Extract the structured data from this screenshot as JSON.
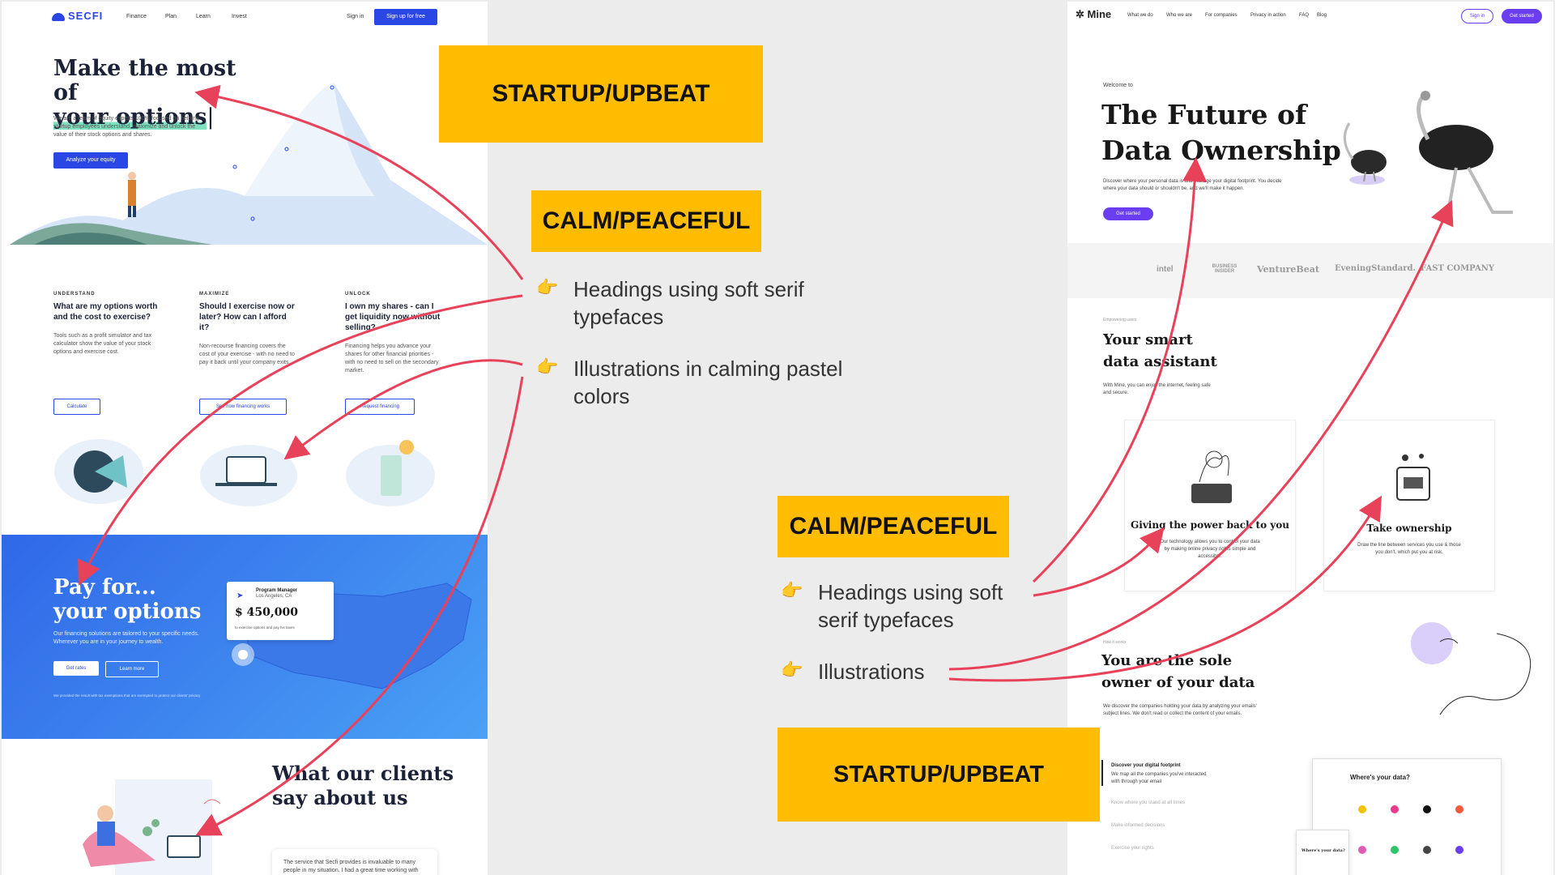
{
  "secfi": {
    "logo": "SECFI",
    "nav": [
      "Finance",
      "Plan",
      "Learn",
      "Invest"
    ],
    "sign_in": "Sign in",
    "signup": "Sign up for free",
    "hero_title_1": "Make the most of",
    "hero_title_2": "your options",
    "hero_body": "We are a team of equity experts 100% focused on helping startup employees understand, maximize and unlock the value of their stock options and shares.",
    "hero_cta": "Analyze your equity",
    "columns": [
      {
        "label": "UNDERSTAND",
        "question": "What are my options worth and the cost to exercise?",
        "body": "Tools such as a profit simulator and tax calculator show the value of your stock options and exercise cost.",
        "button": "Calculate"
      },
      {
        "label": "MAXIMIZE",
        "question": "Should I exercise now or later? How can I afford it?",
        "body": "Non-recourse financing covers the cost of your exercise - with no need to pay it back until your company exits.",
        "button": "See how financing works"
      },
      {
        "label": "UNLOCK",
        "question": "I own my shares - can I get liquidity now without selling?",
        "body": "Financing helps you advance your shares for other financial priorities - with no need to sell on the secondary market.",
        "button": "Request financing"
      }
    ],
    "pay_title_1": "Pay for...",
    "pay_title_2": "your options",
    "pay_body": "Our financing solutions are tailored to your specific needs. Wherever you are in your journey to wealth.",
    "get_rates": "Get rates",
    "learn_more": "Learn more",
    "pay_footnote": "We provided the result with tax exemptions that are exempted to protect our clients' privacy",
    "card_role": "Program Manager",
    "card_location": "Los Angeles, CA",
    "card_amount": "$ 450,000",
    "card_caption": "to exercise options and pay his taxes",
    "clients_title_1": "What our clients",
    "clients_title_2": "say about us",
    "quote": "The service that Secfi provides is invaluable to many people in my situation. I had a great time working with"
  },
  "annotations": {
    "tag_top_left": "STARTUP/UPBEAT",
    "tag_calm_left": "CALM/PEACEFUL",
    "bullets_left": [
      "Headings using soft serif typefaces",
      "Illustrations in calming pastel colors"
    ],
    "tag_calm_right": "CALM/PEACEFUL",
    "bullets_right": [
      "Headings using soft serif typefaces",
      "Illustrations"
    ],
    "tag_bottom_right": "STARTUP/UPBEAT",
    "pointer_icon": "👉",
    "tag_color": "#ffbc00",
    "arrow_color": "#e8415a"
  },
  "mine": {
    "logo": "Mine",
    "nav": [
      "What we do",
      "Who we are",
      "For companies",
      "Privacy in action",
      "FAQ",
      "Blog"
    ],
    "sign_in": "Sign in",
    "get_started": "Get started",
    "welcome": "Welcome to",
    "hero_title_1": "The Future of",
    "hero_title_2": "Data Ownership",
    "hero_body": "Discover where your personal data is and manage your digital footprint. You decide where your data should or shouldn't be, and we'll make it happen.",
    "hero_cta": "Get started",
    "press": [
      "intel",
      "BUSINESS INSIDER",
      "VentureBeat",
      "EveningStandard.",
      "FAST COMPANY"
    ],
    "eyebrow": "Empowering users",
    "assistant_title_1": "Your smart",
    "assistant_title_2": "data assistant",
    "assistant_body": "With Mine, you can enjoy the internet, feeling safe and secure.",
    "card1_title": "Giving the power back to you",
    "card1_body": "Our technology allows you to control your data by making online privacy rights simple and accessible.",
    "card2_title": "Take ownership",
    "card2_body": "Draw the line between services you use & those you don't, which put you at risk.",
    "howit": "How it works",
    "sole_title_1": "You are the sole",
    "sole_title_2": "owner of your data",
    "sole_body": "We discover the companies holding your data by analyzing your emails' subject lines. We don't read or collect the content of your emails.",
    "steps": [
      "Discover your digital footprint",
      "Know where you stand at all times",
      "Make informed decisions",
      "Exercise your rights"
    ],
    "step1_body": "We map all the companies you've interacted with through your email",
    "app_title": "Where's your data?",
    "app_mini_title": "Where's your data?"
  }
}
